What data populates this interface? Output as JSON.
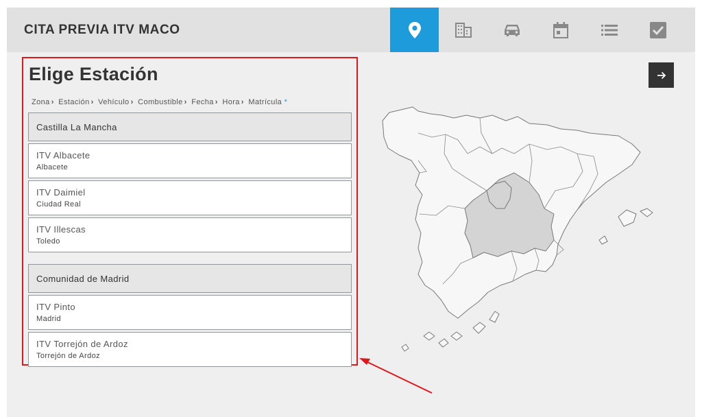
{
  "header": {
    "title": "CITA PREVIA ITV MACO",
    "steps": [
      {
        "icon": "location-pin-icon",
        "active": true
      },
      {
        "icon": "building-icon",
        "active": false
      },
      {
        "icon": "car-icon",
        "active": false
      },
      {
        "icon": "calendar-icon",
        "active": false
      },
      {
        "icon": "list-icon",
        "active": false
      },
      {
        "icon": "checkbox-icon",
        "active": false
      }
    ]
  },
  "panel": {
    "title": "Elige Estación",
    "breadcrumb": [
      "Zona",
      "Estación",
      "Vehículo",
      "Combustible",
      "Fecha",
      "Hora",
      "Matrícula"
    ],
    "required_mark": "*",
    "regions": [
      {
        "name": "Castilla La Mancha",
        "stations": [
          {
            "name": "ITV Albacete",
            "city": "Albacete"
          },
          {
            "name": "ITV Daimiel",
            "city": "Ciudad Real"
          },
          {
            "name": "ITV Illescas",
            "city": "Toledo"
          }
        ]
      },
      {
        "name": "Comunidad de Madrid",
        "stations": [
          {
            "name": "ITV Pinto",
            "city": "Madrid"
          },
          {
            "name": "ITV Torrejón de Ardoz",
            "city": "Torrejón de Ardoz"
          }
        ]
      }
    ]
  },
  "next_button": {
    "icon": "arrow-right-icon"
  },
  "map": {
    "highlighted_region": "Castilla La Mancha",
    "highlight_color": "#d4d4d4"
  },
  "colors": {
    "accent": "#1e9bdb",
    "header_bg": "#e1e1e1",
    "page_bg": "#efefef",
    "annotation_red": "#e0161a",
    "next_button_bg": "#333333"
  }
}
